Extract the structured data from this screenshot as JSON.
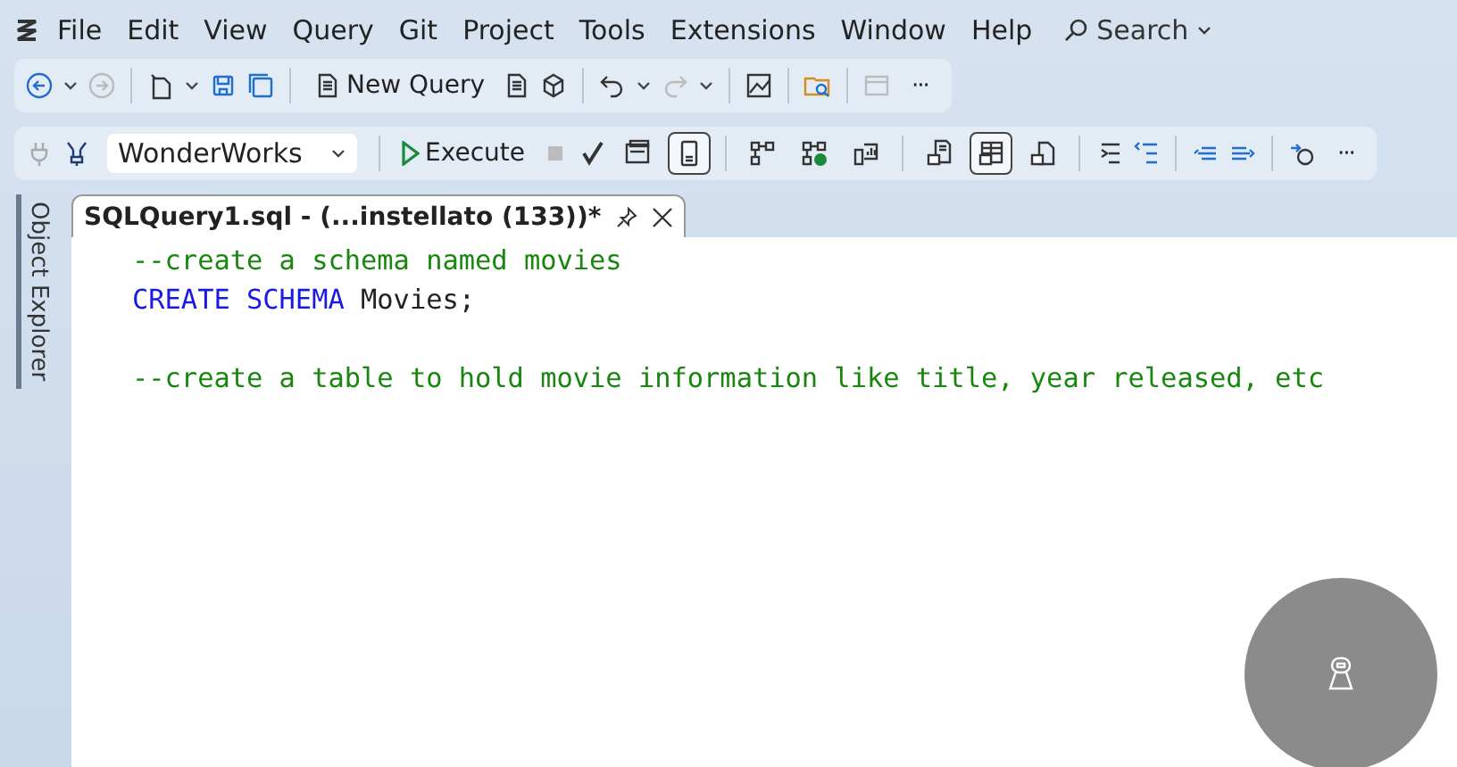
{
  "menu": [
    "File",
    "Edit",
    "View",
    "Query",
    "Git",
    "Project",
    "Tools",
    "Extensions",
    "Window",
    "Help"
  ],
  "search": {
    "label": "Search"
  },
  "standard_toolbar": {
    "new_query": "New Query",
    "more": "···"
  },
  "query_toolbar": {
    "database": "WonderWorks",
    "execute": "Execute",
    "more": "···",
    "toggles": [
      {
        "on": false
      },
      {
        "on": true
      },
      {
        "on": false
      },
      {
        "on": false
      },
      {
        "on": false
      },
      {
        "on": false
      },
      {
        "on": true
      },
      {
        "on": false
      }
    ]
  },
  "side_tab": {
    "label": "Object Explorer"
  },
  "tabs": [
    {
      "title": "SQLQuery1.sql - (...instellato (133))*",
      "selected": true
    }
  ],
  "editor": {
    "blocks": [
      {
        "lines": [
          {
            "tokens": [
              {
                "kind": "comment",
                "text": "--create a schema named movies"
              }
            ]
          },
          {
            "tokens": [
              {
                "kind": "keyword",
                "text": "CREATE SCHEMA"
              },
              {
                "kind": "plain",
                "text": " Movies;"
              }
            ]
          }
        ]
      },
      {
        "lines": [
          {
            "tokens": [
              {
                "kind": "comment",
                "text": "--create a table to hold movie information like title, year released, etc"
              }
            ]
          }
        ]
      }
    ]
  }
}
